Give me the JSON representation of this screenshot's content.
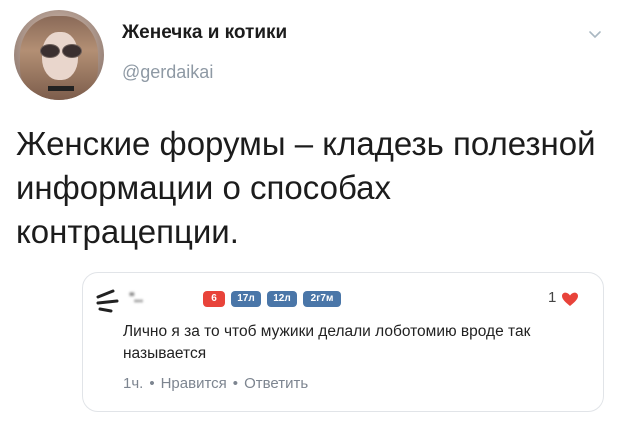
{
  "header": {
    "name": "Женечка и котики",
    "handle": "@gerdaikai",
    "menu_icon": "chevron-down-icon"
  },
  "tweet": {
    "text": "Женские форумы – кладезь полезной информации о способах контрацепции."
  },
  "comment": {
    "author_name": "ʹʹ...",
    "badges": [
      "6",
      "17л",
      "12л",
      "2г7м"
    ],
    "likes": "1",
    "text": "Лично я за то чтоб мужики делали лоботомию вроде так называется",
    "time": "1ч.",
    "like_action": "Нравится",
    "reply_action": "Ответить",
    "colors": {
      "badge_red": "#e8433a",
      "badge_blue": "#4a76a8",
      "heart": "#e8433a"
    }
  }
}
